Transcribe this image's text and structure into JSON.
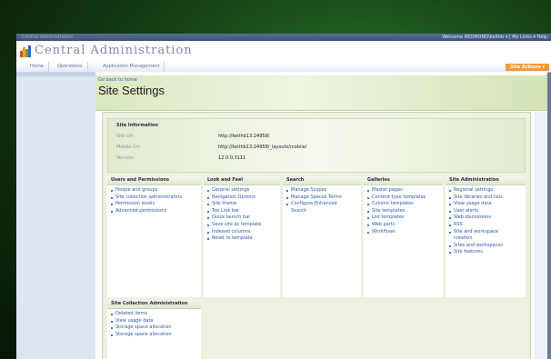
{
  "topbar": {
    "left_text": "Central Administration",
    "welcome": "Welcome REDMOND\\keithb ▾ | My Links ▾ Help"
  },
  "header": {
    "title": "Central Administration"
  },
  "tabs": [
    {
      "label": "Home"
    },
    {
      "label": "Operations"
    },
    {
      "label": "Application Management"
    }
  ],
  "site_actions": "Site Actions ▾",
  "page": {
    "go_back": "Go back to home",
    "title": "Site Settings"
  },
  "site_info": {
    "heading": "Site Information",
    "rows": [
      {
        "label": "Site Url:",
        "value": "http://keithb13:24958/"
      },
      {
        "label": "Mobile Url:",
        "value": "http://keithb13:24958/_layouts/mobile/"
      },
      {
        "label": "Version:",
        "value": "12.0.0.3111"
      }
    ]
  },
  "categories": [
    {
      "heading": "Users and Permissions",
      "items": [
        "People and groups",
        "Site collection administrators",
        "Permission levels",
        "Advanced permissions"
      ]
    },
    {
      "heading": "Look and Feel",
      "items": [
        "General settings",
        "Navigation Options",
        "Site theme",
        "Top Link bar",
        "Quick launch bar",
        "Save site as template",
        "Indexed columns",
        "Reset to template"
      ]
    },
    {
      "heading": "Search",
      "items": [
        "Manage Scopes",
        "Manage Special Terms",
        "Configure Enhanced Search"
      ]
    },
    {
      "heading": "Galleries",
      "items": [
        "Master pages",
        "Content type templates",
        "Column templates",
        "Site templates",
        "List templates",
        "Web parts",
        "Workflows"
      ]
    },
    {
      "heading": "Site Administration",
      "items": [
        "Regional settings",
        "Site libraries and lists",
        "View usage data",
        "User alerts",
        "Web discussions",
        "RSS",
        "Site and workspace creation",
        "Sites and workspaces",
        "Site features"
      ]
    },
    {
      "heading": "Site Collection Administration",
      "items": [
        "Deleted items",
        "View usage data",
        "Storage space allocation",
        "Storage space allocation"
      ]
    }
  ],
  "colors": {
    "link": "#2a5aa8",
    "site_actions": "#f29a38",
    "title_band": "#d9e8bf"
  }
}
